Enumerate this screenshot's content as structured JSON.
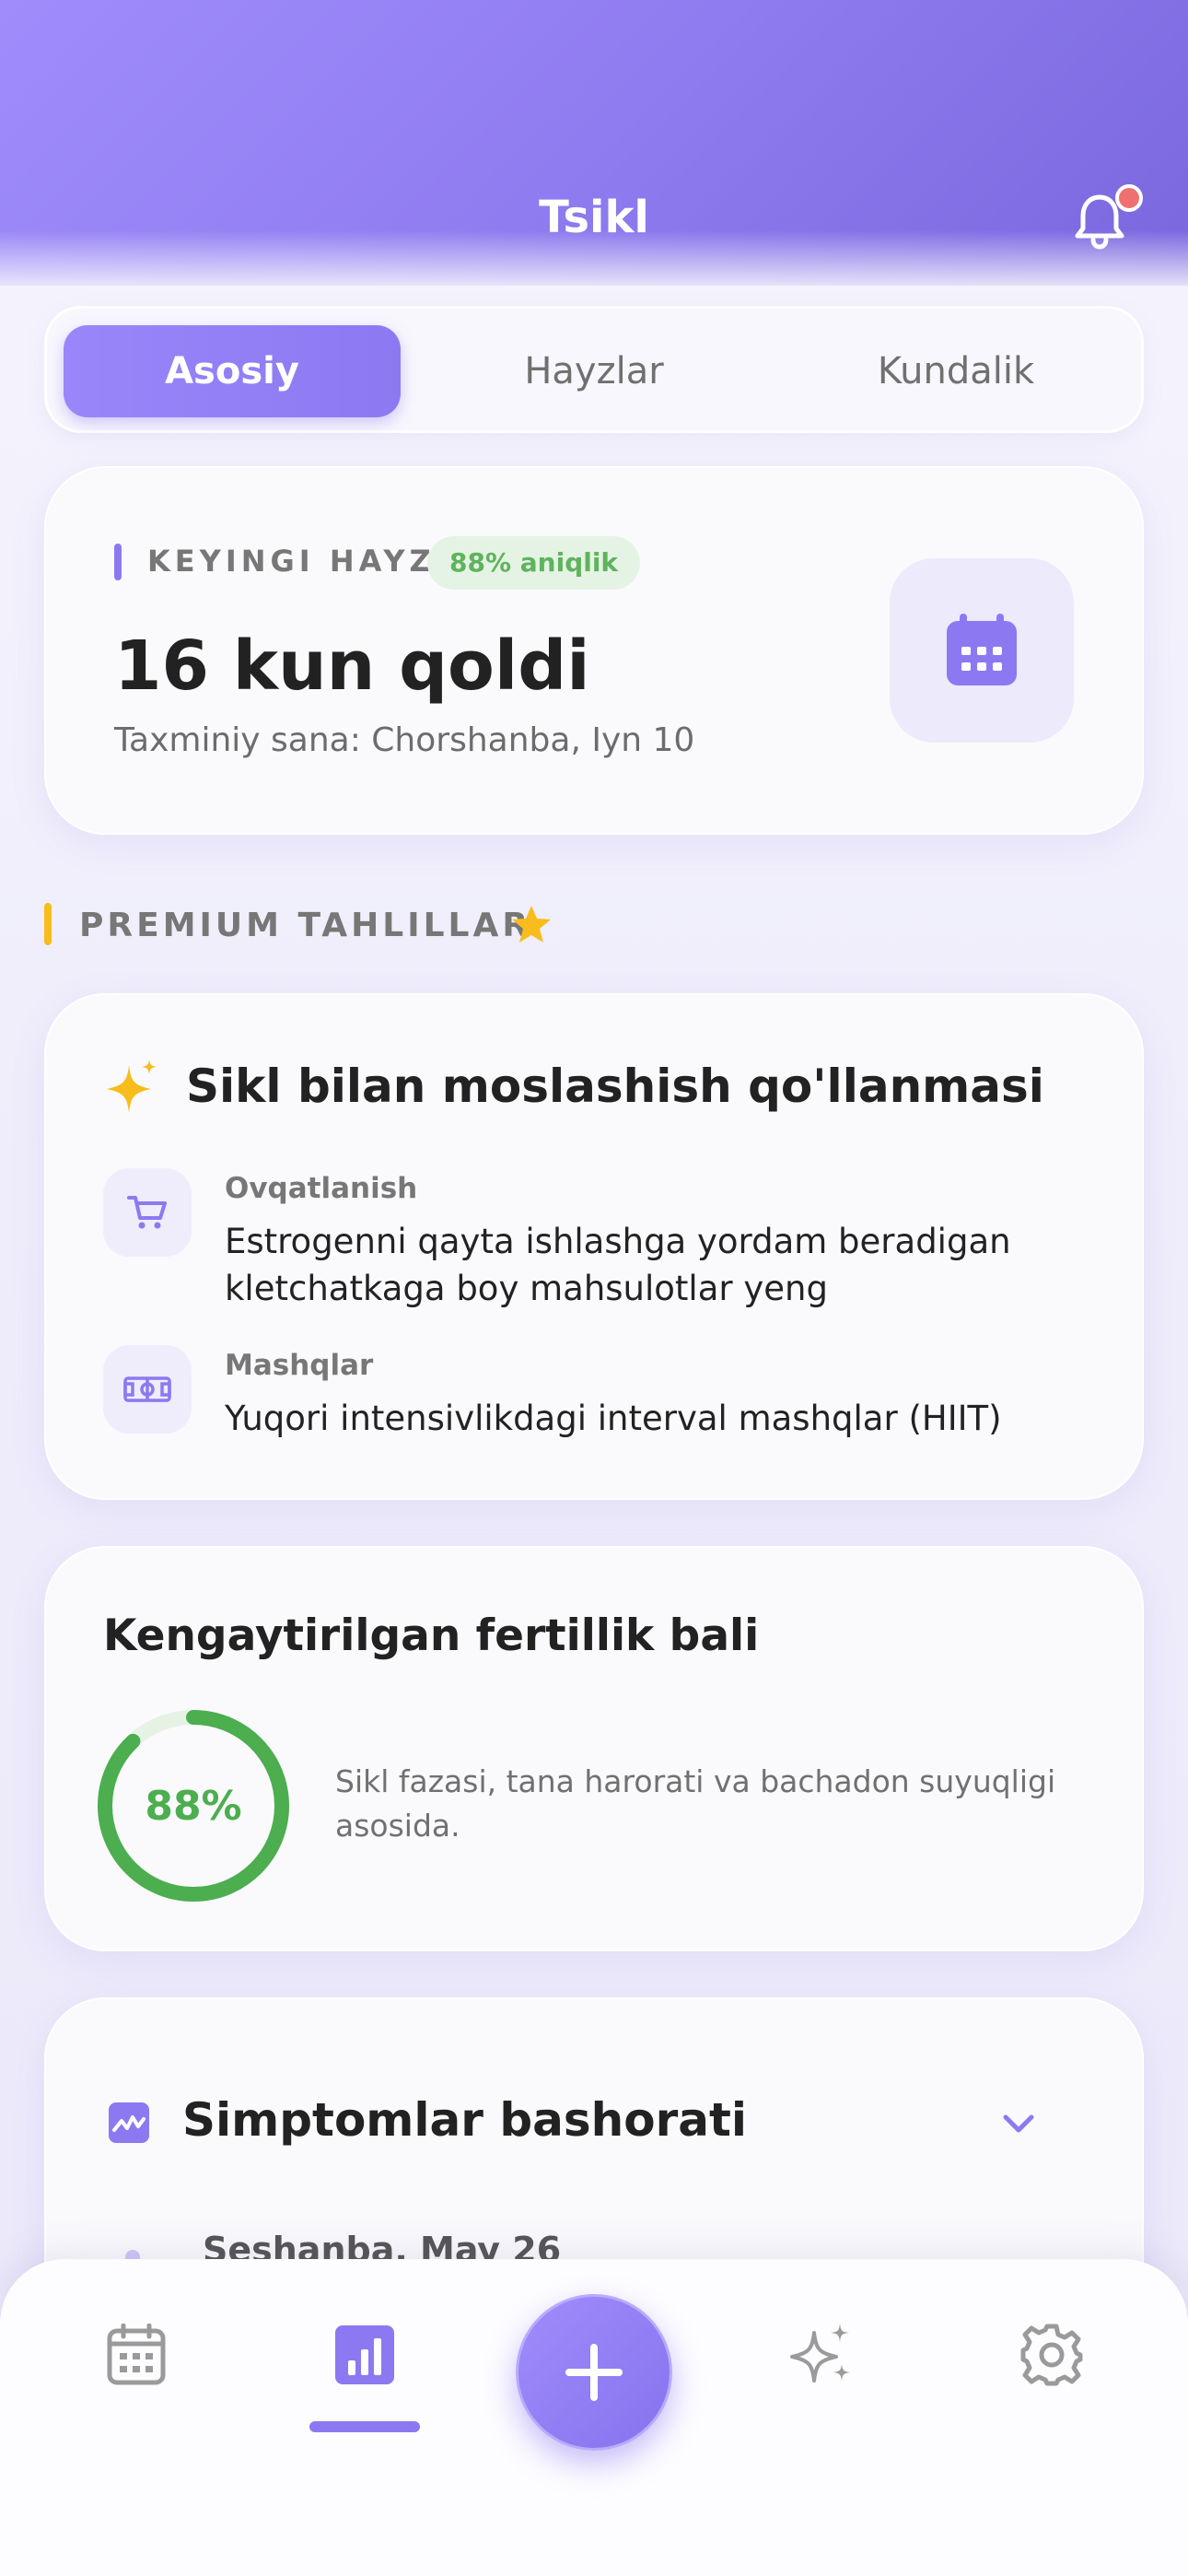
{
  "header": {
    "title": "Tsikl",
    "notification_icon": "bell-icon",
    "has_unread": true
  },
  "tabs": [
    {
      "label": "Asosiy",
      "active": true
    },
    {
      "label": "Hayzlar",
      "active": false
    },
    {
      "label": "Kundalik",
      "active": false
    }
  ],
  "next_period": {
    "label": "KEYINGI HAYZ",
    "accuracy": "88% aniqlik",
    "days_left": "16 kun qoldi",
    "estimated_date": "Taxminiy sana: Chorshanba, Iyn 10",
    "icon": "calendar-icon"
  },
  "premium": {
    "label": "PREMIUM TAHLILLAR",
    "icon": "star-icon"
  },
  "guide": {
    "title": "Sikl bilan moslashish qo'llanmasi",
    "icon": "sparkles-icon",
    "rows": [
      {
        "category": "Ovqatlanish",
        "text": "Estrogenni qayta ishlashga yordam beradigan kletchatkaga boy mahsulotlar yeng",
        "icon": "cart-icon"
      },
      {
        "category": "Mashqlar",
        "text": "Yuqori intensivlikdagi interval mashqlar (HIIT)",
        "icon": "dumbbell-icon"
      }
    ]
  },
  "fertility": {
    "title": "Kengaytirilgan fertillik bali",
    "score_label": "88%",
    "score": 0.88,
    "description": "Sikl fazasi, tana harorati va bachadon suyuqligi asosida."
  },
  "symptoms": {
    "title": "Simptomlar bashorati",
    "icon": "chart-wave-icon",
    "first_row": "Seshanba, May 26"
  },
  "bottom_nav": {
    "items": [
      "calendar-icon",
      "bar-chart-icon",
      "plus-icon",
      "sparkles-icon",
      "gear-icon"
    ],
    "active": "bar-chart-icon"
  },
  "colors": {
    "accent": "#8c79f2",
    "success": "#4cae4f",
    "premium": "#f8bd1c"
  }
}
